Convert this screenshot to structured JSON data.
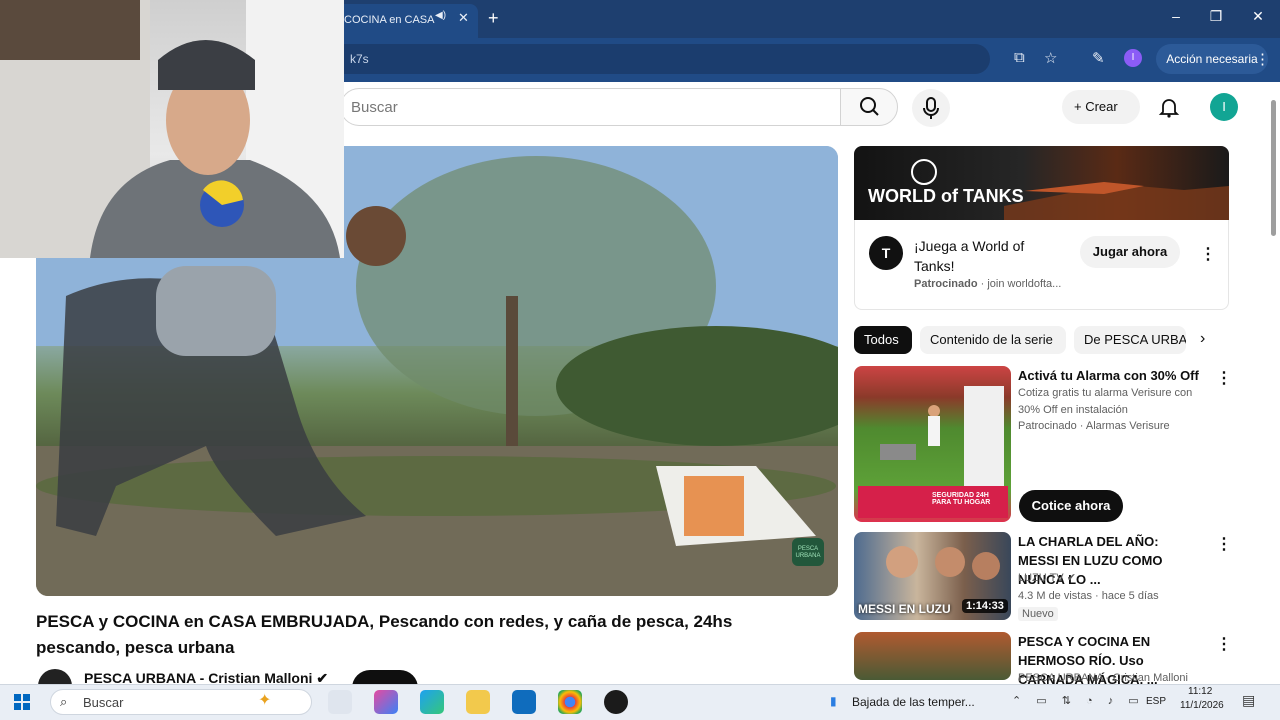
{
  "browser": {
    "tab_title": "COCINA en CASA",
    "tab_close": "✕",
    "new_tab": "+",
    "url_text": "k7s",
    "action_needed": "Acción necesaria",
    "profile_initial": "I",
    "window_controls": [
      "–",
      "❐",
      "✕"
    ]
  },
  "youtube_header": {
    "search_placeholder": "Buscar",
    "create_label": "Crear",
    "avatar_initial": "I"
  },
  "video": {
    "title": "PESCA y COCINA en CASA EMBRUJADA, Pescando con redes, y caña de pesca, 24hs pescando, pesca urbana",
    "channel_name": "PESCA URBANA - Cristian Malloni",
    "watermark_text": "PESCA URBANA"
  },
  "ad": {
    "brand_banner_text": "WORLD of TANKS",
    "logo_glyph": "T",
    "title": "¡Juega a World of Tanks!",
    "sponsored_label": "Patrocinado",
    "sponsored_source": "· join worldofta...",
    "cta": "Jugar ahora"
  },
  "chips": [
    "Todos",
    "Contenido de la serie",
    "De PESCA URBA"
  ],
  "sidebar": [
    {
      "title": "Activá tu Alarma con 30% Off",
      "description": "Cotiza gratis tu alarma Verisure con 30% Off en instalación",
      "sponsored": "Patrocinado · Alarmas Verisure",
      "thumb_badge": "SEGURIDAD 24H PARA TU HOGAR",
      "cta": "Cotice ahora"
    },
    {
      "title": "LA CHARLA DEL AÑO: MESSI EN LUZU COMO NUNCA LO ...",
      "channel": "LUZU TV",
      "meta": "4.3 M de vistas · hace 5 días",
      "badge": "Nuevo",
      "thumb_label": "MESSI EN LUZU",
      "duration": "1:14:33"
    },
    {
      "title": "PESCA Y COCINA EN HERMOSO RÍO. Uso CARNADA MÁGICA. ...",
      "channel": "PESCA URBANA - Cristian Malloni"
    }
  ],
  "taskbar": {
    "search_placeholder": "Buscar",
    "weather": "Bajada de las temper...",
    "language": "ESP",
    "time": "11:12",
    "date": "11/1/2026"
  },
  "colors": {
    "tabbar": "#1e3f6f",
    "toolbar": "#204b86",
    "youtube_text": "#0f0f0f",
    "avatar": "#12a594",
    "taskbar": "#e9eef5"
  }
}
